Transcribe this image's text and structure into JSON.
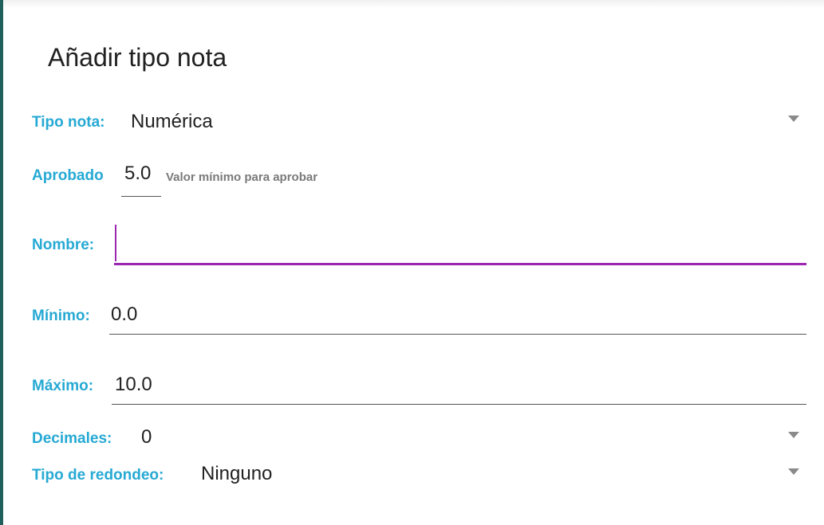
{
  "dialog": {
    "title": "Añadir tipo nota"
  },
  "tipo_nota": {
    "label": "Tipo nota:",
    "value": "Numérica"
  },
  "aprobado": {
    "label": "Aprobado",
    "value": "5.0",
    "hint": "Valor mínimo para aprobar"
  },
  "nombre": {
    "label": "Nombre:",
    "value": ""
  },
  "minimo": {
    "label": "Mínimo:",
    "value": "0.0"
  },
  "maximo": {
    "label": "Máximo:",
    "value": "10.0"
  },
  "decimales": {
    "label": "Decimales:",
    "value": "0"
  },
  "redondeo": {
    "label": "Tipo de redondeo:",
    "value": "Ninguno"
  },
  "icons": {
    "spinner": "chevron-down-icon"
  },
  "colors": {
    "label": "#26a9d4",
    "focus_underline": "#9c27b0",
    "text": "#212121",
    "hint": "#7a7a7a"
  }
}
